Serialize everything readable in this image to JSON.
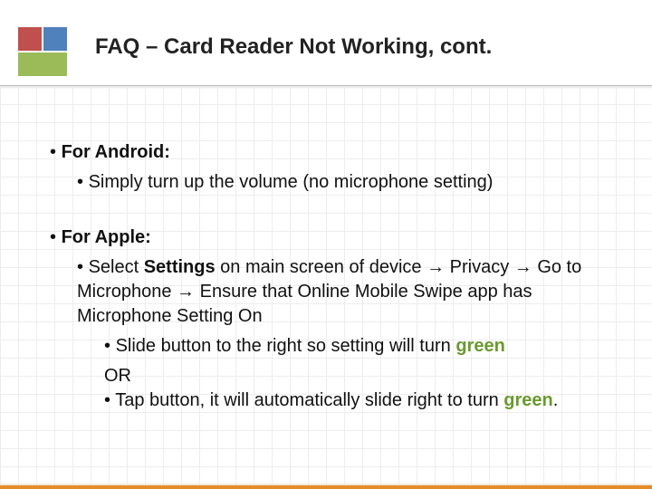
{
  "title": "FAQ – Card Reader Not Working, cont.",
  "sections": [
    {
      "heading": "For Android:",
      "items": [
        {
          "text": "Simply turn up the volume (no microphone setting)"
        }
      ]
    },
    {
      "heading": "For Apple:",
      "items": [
        {
          "prefix": "Select ",
          "bold1": "Settings",
          "mid": " on main screen of device → Privacy → Go to Microphone → Ensure that Online Mobile Swipe app has Microphone Setting On",
          "sub": [
            {
              "text": "Slide button to the right so setting will turn ",
              "green": "green"
            }
          ],
          "or": "OR",
          "sub2": [
            {
              "text": "Tap button, it will automatically slide right to turn ",
              "green": "green",
              "suffix": "."
            }
          ]
        }
      ]
    }
  ]
}
